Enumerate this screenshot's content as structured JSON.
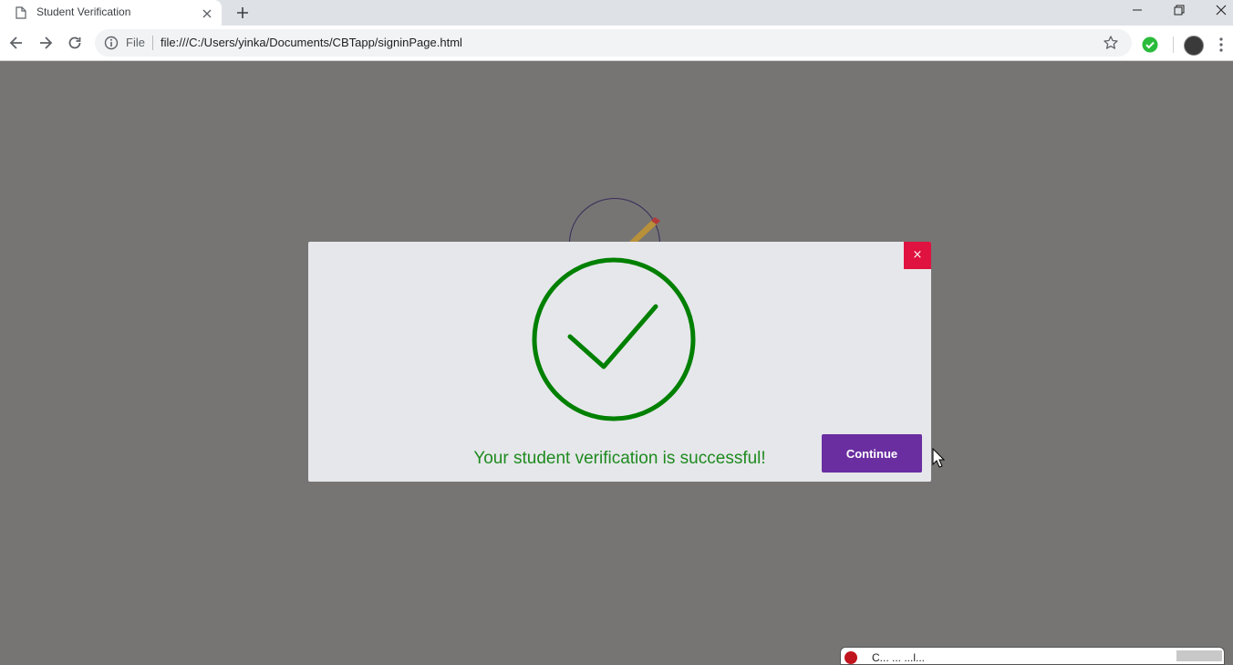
{
  "browser": {
    "tab_title": "Student Verification",
    "scheme_label": "File",
    "url": "file:///C:/Users/yinka/Documents/CBTapp/signinPage.html"
  },
  "modal": {
    "close_label": "×",
    "message": "Your student verification is successful!",
    "continue_label": "Continue",
    "accent_color": "#6a2ea0",
    "success_color": "#008000",
    "close_color": "#e0123f"
  },
  "bottom_popup": {
    "title": "C... ... ...l..."
  },
  "icons": [
    "doc-icon",
    "close-icon",
    "plus-icon",
    "minimize-icon",
    "restore-icon",
    "window-close-icon",
    "back-icon",
    "forward-icon",
    "reload-icon",
    "info-icon",
    "star-icon",
    "check-extension-icon",
    "avatar",
    "kebab-menu-icon",
    "checkmark-circle-icon",
    "pencil-icon",
    "cursor-icon"
  ]
}
